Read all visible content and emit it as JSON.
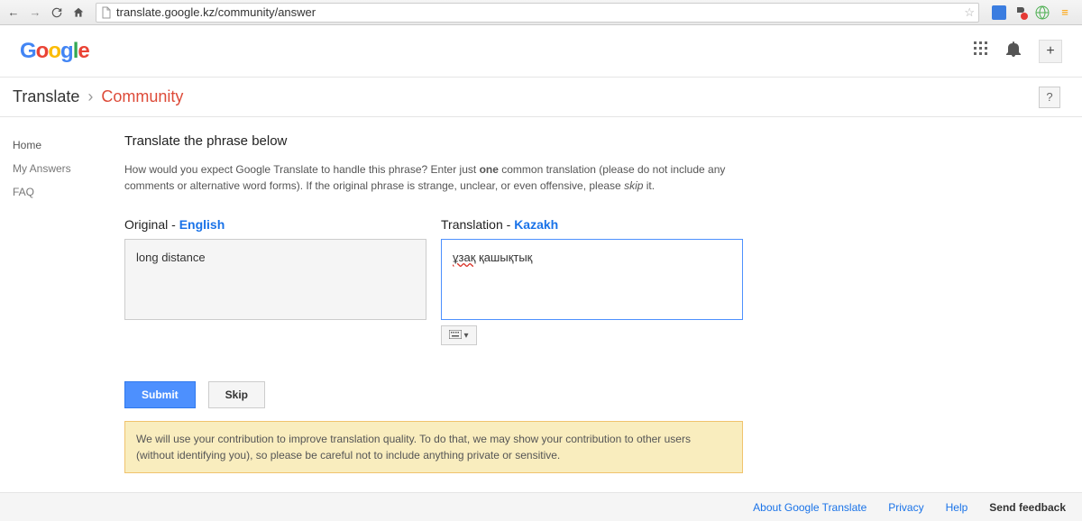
{
  "browser": {
    "url": "translate.google.kz/community/answer"
  },
  "header": {
    "logo_text": [
      "G",
      "o",
      "o",
      "g",
      "l",
      "e"
    ],
    "plus_label": "+"
  },
  "appbar": {
    "product": "Translate",
    "separator": "›",
    "section": "Community",
    "help": "?"
  },
  "sidebar": {
    "items": [
      {
        "label": "Home"
      },
      {
        "label": "My Answers"
      },
      {
        "label": "FAQ"
      }
    ]
  },
  "content": {
    "title": "Translate the phrase below",
    "instructions_pre": "How would you expect Google Translate to handle this phrase? Enter just ",
    "instructions_bold": "one",
    "instructions_mid": " common translation (please do not include any comments or alternative word forms). If the original phrase is strange, unclear, or even offensive, please ",
    "instructions_italic": "skip",
    "instructions_post": " it.",
    "original_label": "Original - ",
    "original_lang": "English",
    "translation_label": "Translation - ",
    "translation_lang": "Kazakh",
    "original_text": "long distance",
    "translation_word1": "ұзақ",
    "translation_word2": " қашықтық",
    "keyboard_dropdown": "▾",
    "submit": "Submit",
    "skip": "Skip",
    "notice": "We will use your contribution to improve translation quality. To do that, we may show your contribution to other users (without identifying you), so please be careful not to include anything private or sensitive."
  },
  "footer": {
    "about": "About Google Translate",
    "privacy": "Privacy",
    "help": "Help",
    "feedback": "Send feedback"
  }
}
